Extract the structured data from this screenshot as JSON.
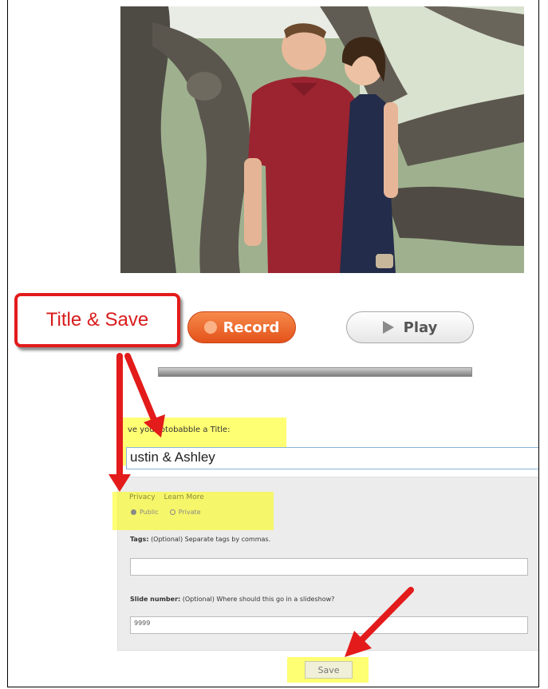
{
  "callout": {
    "text": "Title & Save"
  },
  "buttons": {
    "record_label": "Record",
    "play_label": "Play",
    "save_label": "Save"
  },
  "title_section": {
    "prompt": "ve your otobabble a Title:",
    "value": "ustin & Ashley"
  },
  "privacy": {
    "label": "Privacy",
    "learn_more": "Learn More",
    "public_label": "Public",
    "private_label": "Private"
  },
  "tags": {
    "label_bold": "Tags:",
    "label_hint": "(Optional) Separate tags by commas."
  },
  "slide": {
    "label_bold": "Slide number:",
    "label_hint": "(Optional) Where should this go in a slideshow?",
    "value": "9999"
  },
  "colors": {
    "record": "#e4521b",
    "callout_red": "#e31b1b",
    "highlight": "#ffff00"
  },
  "icons": {
    "record": "record-icon",
    "play": "play-icon"
  }
}
